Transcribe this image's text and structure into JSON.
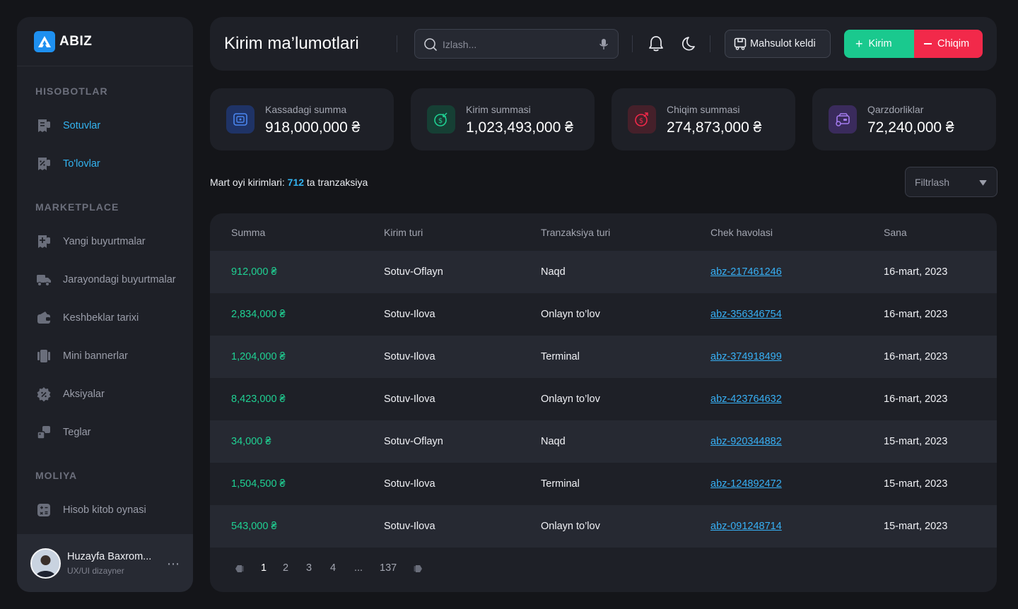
{
  "brand": {
    "name": "ABIZ"
  },
  "sidebar": {
    "sections": [
      {
        "title": "HISOBOTLAR"
      },
      {
        "title": "MARKETPLACE"
      },
      {
        "title": "MOLIYA"
      }
    ],
    "items": [
      {
        "label": "Sotuvlar",
        "icon": "receipt-icon"
      },
      {
        "label": "To'lovlar",
        "icon": "receipt-percent-icon"
      },
      {
        "label": "Yangi buyurtmalar",
        "icon": "receipt-plus-icon"
      },
      {
        "label": "Jarayondagi buyurtmalar",
        "icon": "truck-icon"
      },
      {
        "label": "Keshbeklar tarixi",
        "icon": "wallet-icon"
      },
      {
        "label": "Mini bannerlar",
        "icon": "slides-icon"
      },
      {
        "label": "Aksiyalar",
        "icon": "discount-icon"
      },
      {
        "label": "Teglar",
        "icon": "tags-icon"
      },
      {
        "label": "Hisob kitob oynasi",
        "icon": "calculator-icon"
      }
    ],
    "user": {
      "name": "Huzayfa Baxrom...",
      "role": "UX/UI dizayner"
    }
  },
  "header": {
    "title": "Kirim ma’lumotlari",
    "search_placeholder": "Izlash...",
    "mahsulot_label": "Mahsulot keldi",
    "kirim_label": "Kirim",
    "chiqim_label": "Chiqim"
  },
  "cards": [
    {
      "label": "Kassadagi summa",
      "value": "918,000,000 ₴",
      "icon": "cash-register-icon"
    },
    {
      "label": "Kirim summasi",
      "value": "1,023,493,000 ₴",
      "icon": "coin-in-icon"
    },
    {
      "label": "Chiqim summasi",
      "value": "274,873,000 ₴",
      "icon": "coin-out-icon"
    },
    {
      "label": "Qarzdorliklar",
      "value": "72,240,000 ₴",
      "icon": "debt-icon"
    }
  ],
  "info": {
    "prefix": "Mart oyi kirimlari:",
    "count": "712",
    "suffix": "ta tranzaksiya"
  },
  "filter": {
    "label": "Filtrlash"
  },
  "table": {
    "headers": [
      "Summa",
      "Kirim turi",
      "Tranzaksiya turi",
      "Chek havolasi",
      "Sana"
    ],
    "rows": [
      [
        "912,000 ₴",
        "Sotuv-Oflayn",
        "Naqd",
        "abz-217461246",
        "16-mart, 2023"
      ],
      [
        "2,834,000 ₴",
        "Sotuv-Ilova",
        "Onlayn to’lov",
        "abz-356346754",
        "16-mart, 2023"
      ],
      [
        "1,204,000 ₴",
        "Sotuv-Ilova",
        "Terminal",
        "abz-374918499",
        "16-mart, 2023"
      ],
      [
        "8,423,000 ₴",
        "Sotuv-Ilova",
        "Onlayn to’lov",
        "abz-423764632",
        "16-mart, 2023"
      ],
      [
        "34,000 ₴",
        "Sotuv-Oflayn",
        "Naqd",
        "abz-920344882",
        "15-mart, 2023"
      ],
      [
        "1,504,500 ₴",
        "Sotuv-Ilova",
        "Terminal",
        "abz-124892472",
        "15-mart, 2023"
      ],
      [
        "543,000 ₴",
        "Sotuv-Ilova",
        "Onlayn to’lov",
        "abz-091248714",
        "15-mart, 2023"
      ]
    ]
  },
  "pagination": {
    "pages": [
      "1",
      "2",
      "3",
      "4",
      "...",
      "137"
    ],
    "current": "1"
  },
  "colors": {
    "accent_blue": "#33b3f0",
    "green": "#1ac98e",
    "red": "#f2294a",
    "panel": "#1e2027",
    "background": "#141519"
  }
}
